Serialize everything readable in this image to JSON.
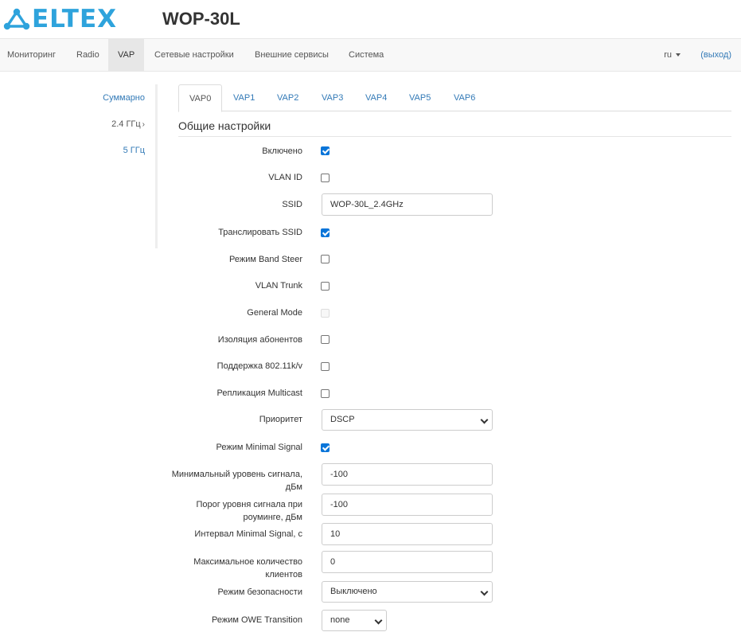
{
  "header": {
    "logo_text": "ELTEX",
    "model": "WOP-30L",
    "brand_color": "#2ea3dc"
  },
  "navbar": {
    "items": [
      "Мониторинг",
      "Radio",
      "VAP",
      "Сетевые настройки",
      "Внешние сервисы",
      "Система"
    ],
    "active": "VAP",
    "lang": "ru",
    "logout": "(выход)"
  },
  "sidebar": {
    "items": [
      "Суммарно",
      "2.4 ГГц",
      "5 ГГц"
    ],
    "active_chevron": "›"
  },
  "tabs": {
    "items": [
      "VAP0",
      "VAP1",
      "VAP2",
      "VAP3",
      "VAP4",
      "VAP5",
      "VAP6"
    ],
    "active": "VAP0"
  },
  "section": {
    "title": "Общие настройки"
  },
  "form": {
    "enabled": {
      "label": "Включено",
      "checked": true
    },
    "vlan_id": {
      "label": "VLAN ID",
      "checked": false
    },
    "ssid": {
      "label": "SSID",
      "value": "WOP-30L_2.4GHz"
    },
    "broadcast_ssid": {
      "label": "Транслировать SSID",
      "checked": true
    },
    "band_steer": {
      "label": "Режим Band Steer",
      "checked": false
    },
    "vlan_trunk": {
      "label": "VLAN Trunk",
      "checked": false
    },
    "general_mode": {
      "label": "General Mode",
      "checked": false,
      "disabled": true
    },
    "isolation": {
      "label": "Изоляция абонентов",
      "checked": false
    },
    "support_80211kv": {
      "label": "Поддержка 802.11k/v",
      "checked": false
    },
    "multicast_replication": {
      "label": "Репликация Multicast",
      "checked": false
    },
    "priority": {
      "label": "Приоритет",
      "value": "DSCP"
    },
    "minimal_signal_mode": {
      "label": "Режим Minimal Signal",
      "checked": true
    },
    "min_signal_level": {
      "label": "Минимальный уровень сигнала, дБм",
      "value": "-100"
    },
    "roaming_threshold": {
      "label": "Порог уровня сигнала при роуминге, дБм",
      "value": "-100"
    },
    "minimal_signal_interval": {
      "label": "Интервал Minimal Signal, с",
      "value": "10"
    },
    "max_clients": {
      "label": "Максимальное количество клиентов",
      "value": "0"
    },
    "security_mode": {
      "label": "Режим безопасности",
      "value": "Выключено"
    },
    "owe_transition": {
      "label": "Режим OWE Transition",
      "value": "none"
    }
  }
}
